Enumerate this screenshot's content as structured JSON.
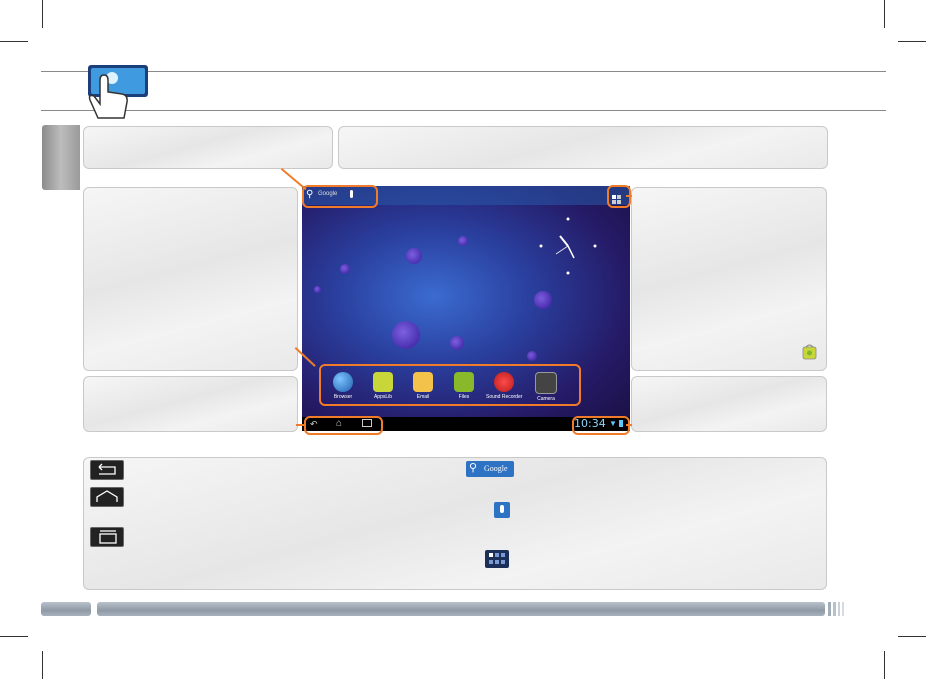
{
  "status_bar": {
    "time": "10:34"
  },
  "apps": [
    {
      "label": "Browser",
      "icon": "globe-icon",
      "color": "#2f7fd0"
    },
    {
      "label": "AppsLib",
      "icon": "android-bag-icon",
      "color": "#c9d63a"
    },
    {
      "label": "Email",
      "icon": "envelope-icon",
      "color": "#f2c24b"
    },
    {
      "label": "Files",
      "icon": "folder-icon",
      "color": "#8ab82b"
    },
    {
      "label": "Sound Recorder",
      "icon": "microphone-record-icon",
      "color": "#d92d2d"
    },
    {
      "label": "Camera",
      "icon": "camera-icon",
      "color": "#555555"
    }
  ],
  "search_widget": {
    "label": "Google"
  },
  "legend_left": [
    {
      "icon": "back-icon"
    },
    {
      "icon": "home-icon"
    },
    {
      "icon": "recent-apps-icon"
    }
  ],
  "legend_right": [
    {
      "icon": "google-search-icon",
      "label": "Google"
    },
    {
      "icon": "microphone-icon"
    },
    {
      "icon": "apps-grid-icon"
    }
  ],
  "colors": {
    "accent": "#f07c2a",
    "panel": "#ececec",
    "bar": "#9aa5b1"
  }
}
